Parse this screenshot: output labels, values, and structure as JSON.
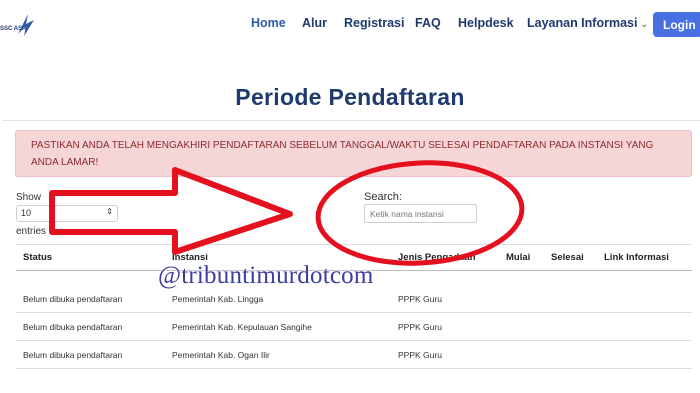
{
  "nav": {
    "logo_text": "SSC ASN",
    "items": [
      {
        "label": "Home",
        "active": true
      },
      {
        "label": "Alur"
      },
      {
        "label": "Registrasi"
      },
      {
        "label": "FAQ"
      },
      {
        "label": "Helpdesk"
      },
      {
        "label": "Layanan Informasi"
      }
    ],
    "login_label": "Login"
  },
  "page_title": "Periode Pendaftaran",
  "alert": "PASTIKAN ANDA TELAH MENGAKHIRI PENDAFTARAN SEBELUM TANGGAL/WAKTU SELESAI PENDAFTARAN PADA INSTANSI YANG ANDA LAMAR!",
  "length_control": {
    "show_label": "Show",
    "selected": "10",
    "entries_label": "entries"
  },
  "search": {
    "label": "Search:",
    "placeholder": "Ketik nama instansi"
  },
  "table": {
    "headers": [
      "Status",
      "Instansi",
      "Jenis Pengadaan",
      "Mulai",
      "Selesai",
      "Link Informasi"
    ],
    "rows": [
      {
        "status": "Belum dibuka pendaftaran",
        "instansi": "Pemerintah Kab. Lingga",
        "jenis": "PPPK Guru"
      },
      {
        "status": "Belum dibuka pendaftaran",
        "instansi": "Pemerintah Kab. Kepulauan Sangihe",
        "jenis": "PPPK Guru"
      },
      {
        "status": "Belum dibuka pendaftaran",
        "instansi": "Pemerintah Kab. Ogan Ilir",
        "jenis": "PPPK Guru"
      }
    ]
  },
  "watermark": "@tribuntimurdotcom",
  "colors": {
    "brand": "#1f3a6e",
    "login": "#4a6fe0",
    "annotation": "#e5101d",
    "alert_bg": "#f6d5d6"
  }
}
